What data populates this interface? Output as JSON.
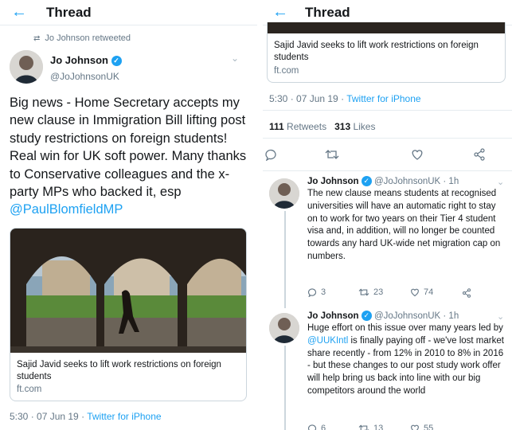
{
  "left": {
    "header": {
      "back_icon": "arrow-left-icon",
      "title": "Thread"
    },
    "retweet_context": {
      "icon": "retweet-icon",
      "text": "Jo Johnson retweeted"
    },
    "author": {
      "name": "Jo Johnson",
      "handle": "@JoJohnsonUK",
      "verified_icon": "verified-badge-icon"
    },
    "tweet": {
      "text": "Big news - Home Secretary accepts my new clause in Immigration Bill lifting post study restrictions on foreign students! Real win for UK soft power. Many thanks to Conservative colleagues and the x-party MPs who backed it, esp ",
      "mention": "@PaulBlomfieldMP"
    },
    "card": {
      "title": "Sajid Javid seeks to lift work restrictions on foreign students",
      "domain": "ft.com"
    },
    "meta": {
      "time": "5:30 · 07 Jun 19 · ",
      "source": "Twitter for iPhone"
    }
  },
  "right": {
    "header": {
      "back_icon": "arrow-left-icon",
      "title": "Thread"
    },
    "card": {
      "title": "Sajid Javid seeks to lift work restrictions on foreign students",
      "domain": "ft.com"
    },
    "meta": {
      "time": "5:30 · 07 Jun 19 · ",
      "source": "Twitter for iPhone"
    },
    "stats": {
      "retweets_count": "111",
      "retweets_label": "Retweets",
      "likes_count": "313",
      "likes_label": "Likes"
    },
    "actions": [
      "reply-icon",
      "retweet-icon",
      "like-icon",
      "share-icon"
    ],
    "replies": [
      {
        "name": "Jo Johnson",
        "handle": "@JoJohnsonUK · 1h",
        "text": "The new clause means students at recognised universities will have an automatic right to stay on to work for two years on their Tier 4 student visa and, in addition, will no longer be counted towards any hard UK-wide net migration cap on numbers.",
        "replies": "3",
        "retweets": "23",
        "likes": "74"
      },
      {
        "name": "Jo Johnson",
        "handle": "@JoJohnsonUK · 1h",
        "text_before": "Huge effort on this issue over many years led by ",
        "mention": "@UUKIntl",
        "text_after": " is finally paying off - we've lost market share recently - from 12% in 2010 to 8% in 2016 - but these changes to our post study work offer will help bring us back into line with our big competitors around the world",
        "replies": "6",
        "retweets": "13",
        "likes": "55"
      }
    ]
  }
}
